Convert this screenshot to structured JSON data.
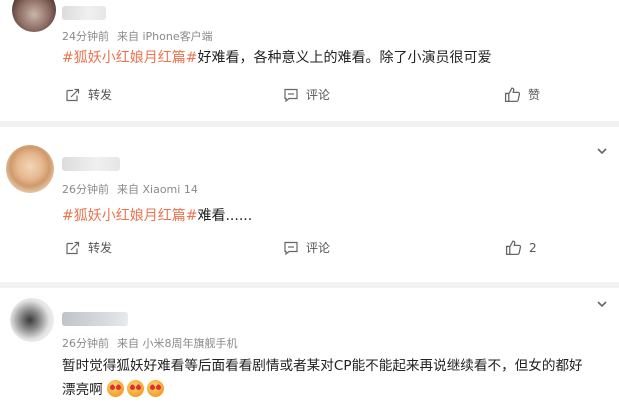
{
  "posts": [
    {
      "meta_time": "24分钟前",
      "meta_source": "来自 iPhone客户端",
      "topic": "#狐妖小红娘月红篇#",
      "text": "好难看，各种意义上的难看。除了小演员很可爱",
      "repost_label": "转发",
      "comment_label": "评论",
      "like_label": "赞",
      "like_count": ""
    },
    {
      "meta_time": "26分钟前",
      "meta_source": "来自 Xiaomi 14",
      "topic": "#狐妖小红娘月红篇#",
      "text": "难看......",
      "repost_label": "转发",
      "comment_label": "评论",
      "like_label": "",
      "like_count": "2"
    },
    {
      "meta_time": "26分钟前",
      "meta_source": "来自 小米8周年旗舰手机",
      "text_line1": "暂时觉得狐妖好难看等后面看看剧情或者某对CP能不能起来再说继续看不，但女的都好",
      "text_line2": "漂亮啊",
      "emoji_count": 3
    }
  ],
  "icons": {
    "repost": "repost-icon",
    "comment": "comment-icon",
    "like": "thumbs-up-icon",
    "expand": "chevron-down-icon"
  },
  "colors": {
    "topic": "#eb7350",
    "meta": "#8a8a8a",
    "divider": "#f2f2f2"
  }
}
